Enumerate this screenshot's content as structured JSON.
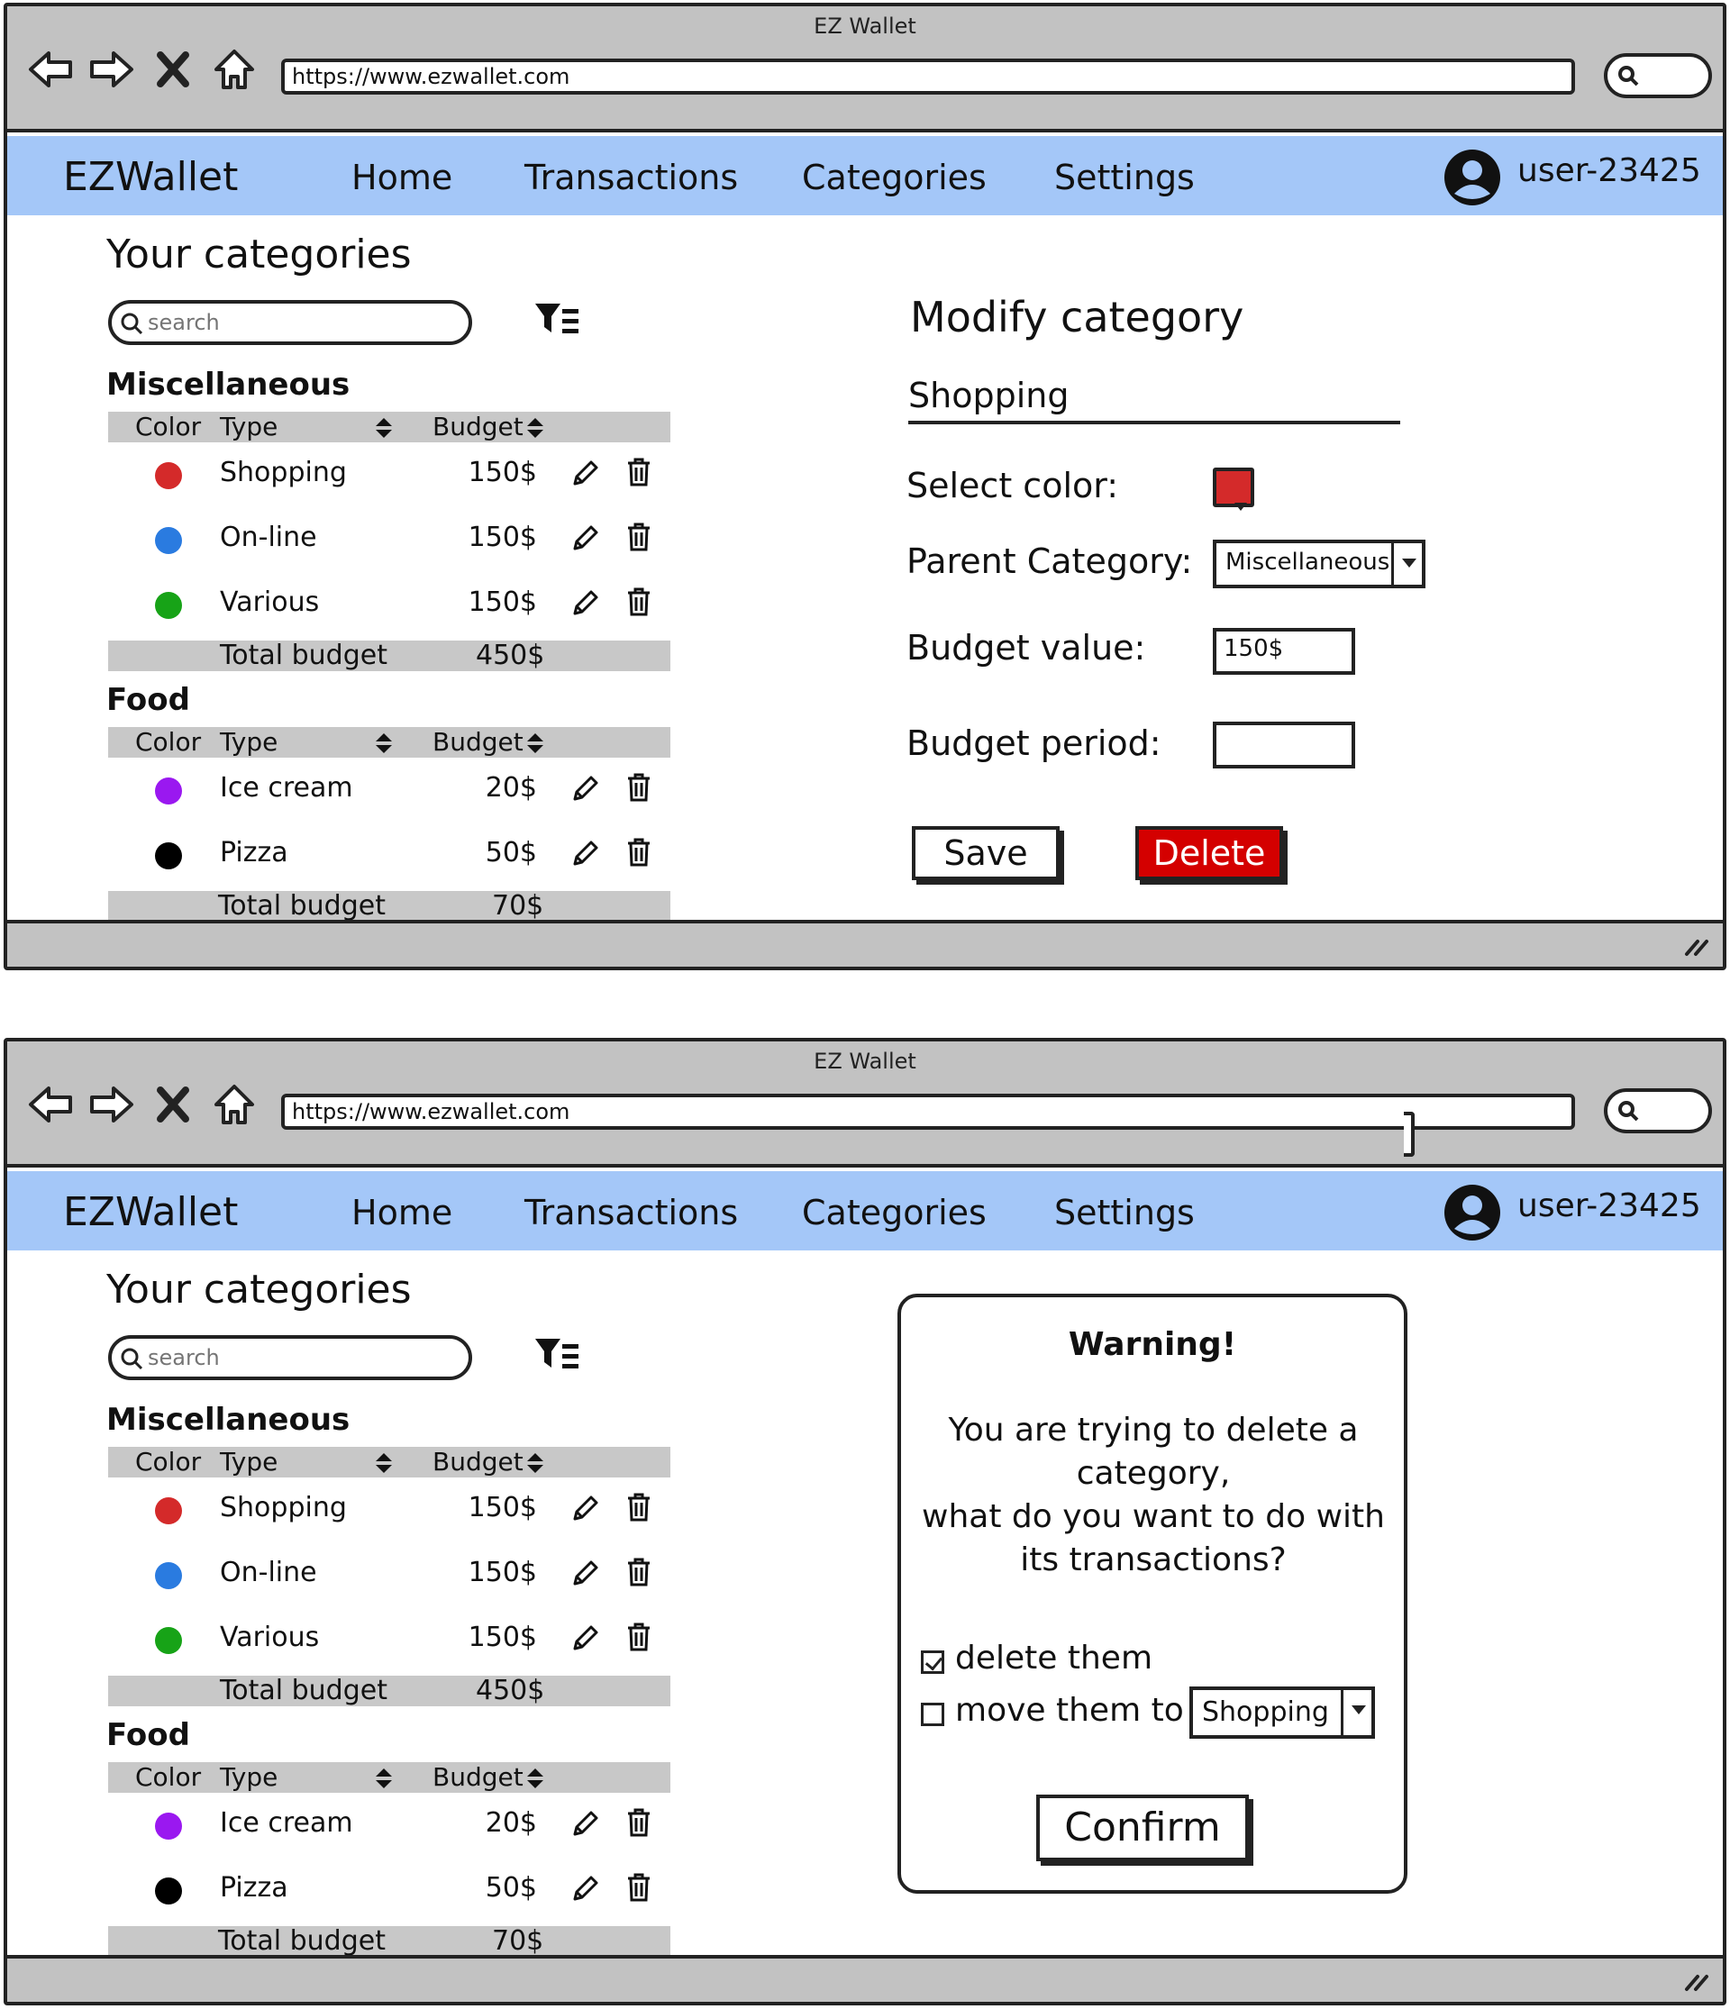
{
  "window": {
    "title": "EZ Wallet",
    "url": "https://www.ezwallet.com"
  },
  "nav": {
    "brand": "EZWallet",
    "items": [
      "Home",
      "Transactions",
      "Categories",
      "Settings"
    ],
    "user": "user-23425"
  },
  "categories": {
    "heading": "Your categories",
    "search_placeholder": "search",
    "columns": {
      "color": "Color",
      "type": "Type",
      "budget": "Budget"
    },
    "total_label": "Total budget",
    "groups": [
      {
        "name": "Miscellaneous",
        "total": "450$",
        "rows": [
          {
            "label": "Shopping",
            "budget": "150$",
            "color": "#d42a2a"
          },
          {
            "label": "On-line",
            "budget": "150$",
            "color": "#2a7be0"
          },
          {
            "label": "Various",
            "budget": "150$",
            "color": "#17a317"
          }
        ]
      },
      {
        "name": "Food",
        "total": "70$",
        "rows": [
          {
            "label": "Ice cream",
            "budget": "20$",
            "color": "#9a18f0"
          },
          {
            "label": "Pizza",
            "budget": "50$",
            "color": "#000000"
          }
        ]
      }
    ]
  },
  "modify": {
    "title": "Modify category",
    "name_value": "Shopping",
    "select_color_label": "Select color:",
    "selected_color": "#d42a2a",
    "parent_label": "Parent Category:",
    "parent_value": "Miscellaneous",
    "budget_value_label": "Budget value:",
    "budget_value": "150$",
    "budget_period_label": "Budget period:",
    "budget_period": "",
    "save": "Save",
    "delete": "Delete"
  },
  "modal": {
    "title": "Warning!",
    "line1": "You are trying to delete a",
    "line2": "category,",
    "line3": "what do you want to do with",
    "line4": "its transactions?",
    "opt_delete": "delete them",
    "opt_delete_checked": true,
    "opt_move": "move them to",
    "opt_move_checked": false,
    "move_target": "Shopping",
    "confirm": "Confirm"
  }
}
